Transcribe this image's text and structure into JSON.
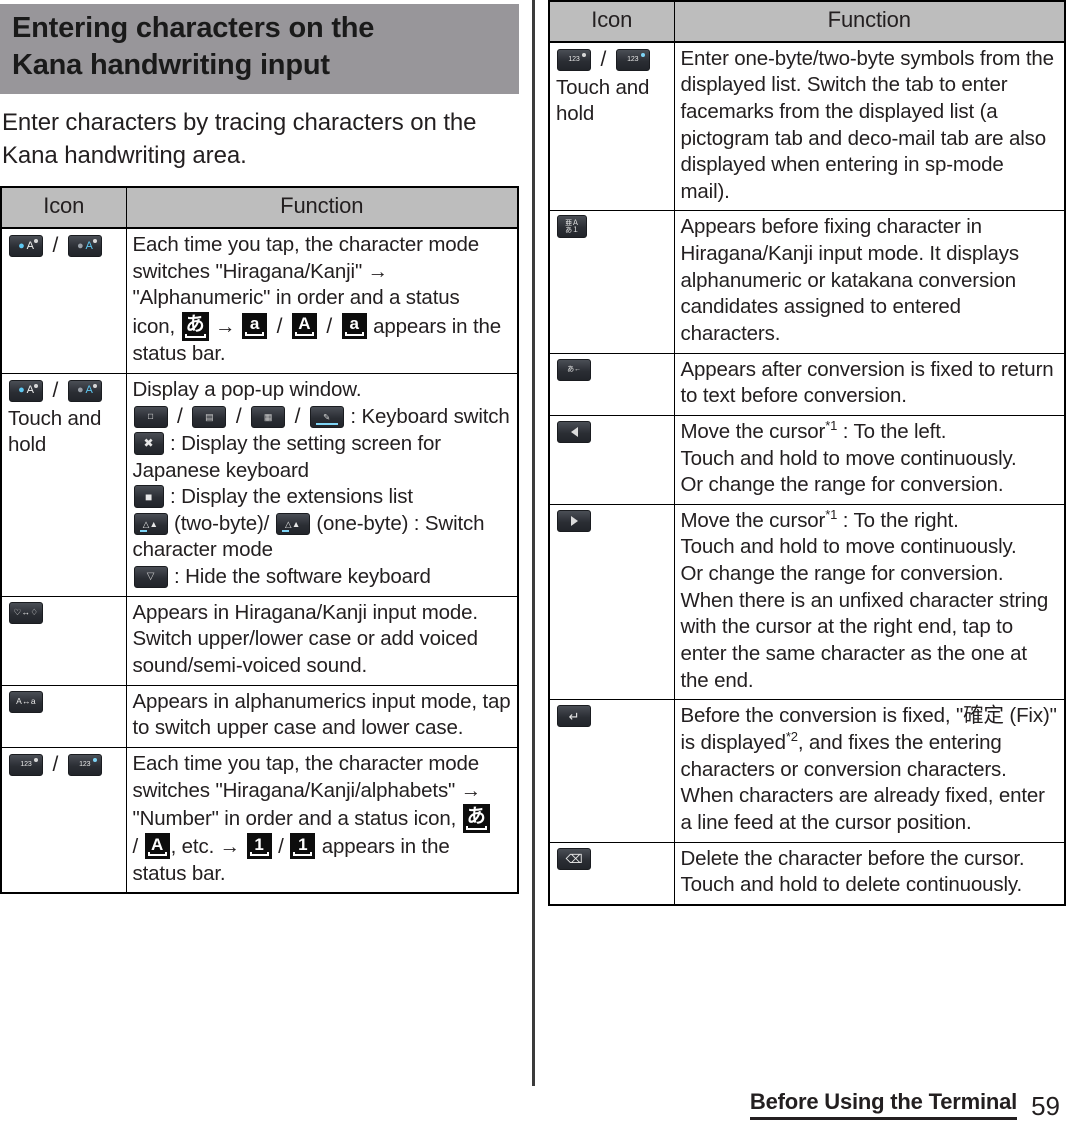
{
  "section": {
    "heading_line1": "Entering characters on the",
    "heading_line2": "Kana handwriting input",
    "intro": "Enter characters by tracing characters on the Kana handwriting area."
  },
  "table_headers": {
    "icon": "Icon",
    "function": "Function"
  },
  "left_table": {
    "rows": [
      {
        "icon_label": "character-mode-switch-keys",
        "touch_hold": "",
        "lines": [
          "Each time you tap, the character mode",
          "switches \"Hiragana/Kanji\" →",
          "\"Alphanumeric\" in order and a status",
          "icon, [あ] → [a] / [A] / [a] appears in the",
          "status bar."
        ],
        "text": "Each time you tap, the character mode switches \"Hiragana/Kanji\" → \"Alphanumeric\" in order and a status icon, あ → a / A / a appears in the status bar."
      },
      {
        "icon_label": "character-mode-switch-keys",
        "touch_hold": "Touch and hold",
        "text": "Display a pop-up window.",
        "bullets": [
          ": Keyboard switch",
          ": Display the setting screen for Japanese keyboard",
          ": Display the extensions list",
          "(two-byte)/ (one-byte) : Switch character mode",
          ": Hide the software keyboard"
        ],
        "b1_tail": ": Keyboard switch",
        "b2_tail": ": Display the setting screen for",
        "b2_cont": "Japanese keyboard",
        "b3_tail": ": Display the extensions list",
        "b4_mid1": "(two-byte)/",
        "b4_mid2": "(one-byte) : Switch",
        "b4_cont": "character mode",
        "b5_tail": ": Hide the software keyboard"
      },
      {
        "icon_label": "upper-lower-voiced-key",
        "touch_hold": "",
        "text": "Appears in Hiragana/Kanji input mode. Switch upper/lower case or add voiced sound/semi-voiced sound."
      },
      {
        "icon_label": "case-switch-key",
        "touch_hold": "",
        "text": "Appears in alphanumerics input mode, tap to switch upper case and lower case."
      },
      {
        "icon_label": "number-mode-keys",
        "touch_hold": "",
        "text": "Each time you tap, the character mode switches \"Hiragana/Kanji/alphabets\" → \"Number\" in order and a status icon, あ / A , etc. → 1 / 1 appears in the status bar.",
        "l1": "Each time you tap, the character mode",
        "l2": "switches \"Hiragana/Kanji/alphabets\" →",
        "l3a": "\"Number\" in order and a status icon,",
        "l4a": "/",
        "l4b": ", etc. →",
        "l4c": "/",
        "l4d": "appears in the",
        "l5": "status bar."
      }
    ]
  },
  "right_table": {
    "rows": [
      {
        "icon_label": "symbol-keys",
        "touch_hold": "Touch and hold",
        "text": "Enter one-byte/two-byte symbols from the displayed list. Switch the tab to enter facemarks from the displayed list (a pictogram tab and deco-mail tab are also displayed when entering in sp-mode mail)."
      },
      {
        "icon_label": "conversion-candidates-key",
        "touch_hold": "",
        "text": "Appears before fixing character in Hiragana/Kanji input mode. It displays alphanumeric or katakana conversion candidates assigned to entered characters."
      },
      {
        "icon_label": "undo-conversion-key",
        "touch_hold": "",
        "text": "Appears after conversion is fixed to return to text before conversion."
      },
      {
        "icon_label": "cursor-left-key",
        "touch_hold": "",
        "text_pre": "Move the cursor",
        "footnote": "*1",
        "text_post": " : To the left.",
        "extra": [
          "Touch and hold to move continuously.",
          "Or change the range for conversion."
        ]
      },
      {
        "icon_label": "cursor-right-key",
        "touch_hold": "",
        "text_pre": "Move the cursor",
        "footnote": "*1",
        "text_post": " : To the right.",
        "extra": [
          "Touch and hold to move continuously.",
          "Or change the range for conversion.",
          "When there is an unfixed character string with the cursor at the right end, tap to enter the same character as the one at the end."
        ]
      },
      {
        "icon_label": "enter-fix-key",
        "touch_hold": "",
        "text_pre": "Before the conversion is fixed, \"確定 (Fix)\" is displayed",
        "footnote": "*2",
        "text_post": ", and fixes the entering characters or conversion characters. When characters are already fixed, enter a line feed at the cursor position."
      },
      {
        "icon_label": "backspace-key",
        "touch_hold": "",
        "text": "Delete the character before the cursor. Touch and hold to delete continuously."
      }
    ]
  },
  "footer": {
    "chapter": "Before Using the Terminal",
    "page": "59"
  },
  "colors": {
    "heading_band": "#98969a",
    "table_header": "#bdbdbd",
    "rule": "#000000",
    "text": "#231f20"
  }
}
